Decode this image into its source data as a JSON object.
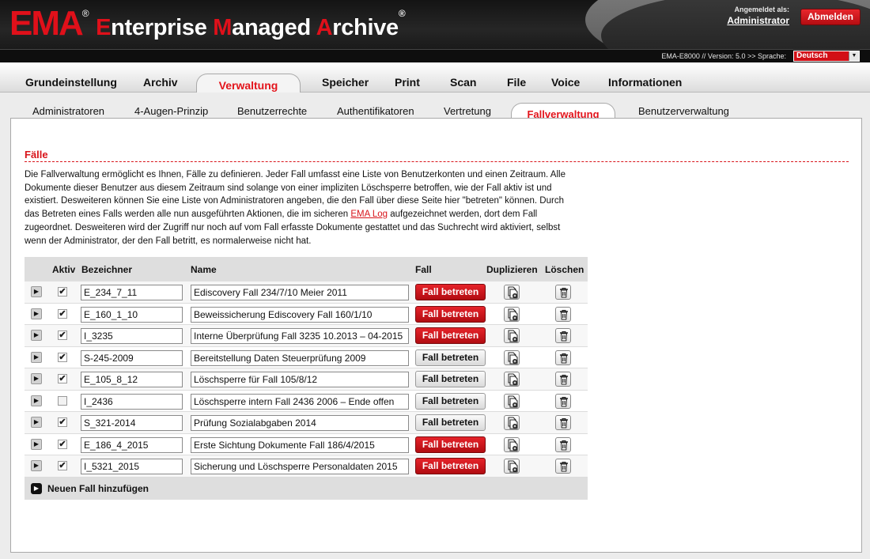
{
  "header": {
    "logo_short": "EMA",
    "logo_reg": "®",
    "title_parts": [
      {
        "cap": "E",
        "rest": "nterprise "
      },
      {
        "cap": "M",
        "rest": "anaged "
      },
      {
        "cap": "A",
        "rest": "rchive"
      }
    ],
    "title_reg": "®",
    "login_label": "Angemeldet als:",
    "login_user": "Administrator",
    "logout_label": "Abmelden"
  },
  "version_bar": {
    "text": "EMA-E8000 // Version: 5.0 >> Sprache:",
    "language": "Deutsch"
  },
  "main_tabs": [
    {
      "label": "Grundeinstellung"
    },
    {
      "label": "Archiv"
    },
    {
      "label": "Verwaltung",
      "active": true
    },
    {
      "label": "Speicher"
    },
    {
      "label": "Print"
    },
    {
      "label": "Scan"
    },
    {
      "label": "File"
    },
    {
      "label": "Voice"
    },
    {
      "label": "Informationen"
    }
  ],
  "sub_tabs": [
    {
      "label": "Administratoren"
    },
    {
      "label": "4-Augen-Prinzip"
    },
    {
      "label": "Benutzerrechte"
    },
    {
      "label": "Authentifikatoren"
    },
    {
      "label": "Vertretung"
    },
    {
      "label": "Fallverwaltung",
      "active": true
    },
    {
      "label": "Benutzerverwaltung"
    }
  ],
  "content": {
    "section_title": "Fälle",
    "intro_before_link": "Die Fallverwaltung ermöglicht es Ihnen, Fälle zu definieren. Jeder Fall umfasst eine Liste von Benutzerkonten und einen Zeitraum. Alle Dokumente dieser Benutzer aus diesem Zeitraum sind solange von einer impliziten Löschsperre betroffen, wie der Fall aktiv ist und existiert. Desweiteren können Sie eine Liste von Administratoren angeben, die den Fall über diese Seite hier \"betreten\" können. Durch das Betreten eines Falls werden alle nun ausgeführten Aktionen, die im sicheren ",
    "intro_link": "EMA Log",
    "intro_after_link": " aufgezeichnet werden, dort dem Fall zugeordnet. Desweiteren wird der Zugriff nur noch auf vom Fall erfasste Dokumente gestattet und das Suchrecht wird aktiviert, selbst wenn der Administrator, der den Fall betritt, es normalerweise nicht hat."
  },
  "table": {
    "headers": {
      "aktiv": "Aktiv",
      "bezeichner": "Bezeichner",
      "name": "Name",
      "fall": "Fall",
      "duplizieren": "Duplizieren",
      "loeschen": "Löschen"
    },
    "enter_label": "Fall betreten",
    "rows": [
      {
        "active": true,
        "code": "E_234_7_11",
        "name": "Ediscovery Fall 234/7/10 Meier 2011",
        "entered": true
      },
      {
        "active": true,
        "code": "E_160_1_10",
        "name": "Beweissicherung Ediscovery Fall 160/1/10",
        "entered": true
      },
      {
        "active": true,
        "code": "I_3235",
        "name": "Interne Überprüfung Fall 3235 10.2013 – 04-2015",
        "entered": true
      },
      {
        "active": true,
        "code": "S-245-2009",
        "name": "Bereitstellung Daten Steuerprüfung 2009",
        "entered": false
      },
      {
        "active": true,
        "code": "E_105_8_12",
        "name": "Löschsperre für Fall 105/8/12",
        "entered": false
      },
      {
        "active": false,
        "code": "I_2436",
        "name": "Löschsperre intern Fall 2436 2006 – Ende offen",
        "entered": false
      },
      {
        "active": true,
        "code": "S_321-2014",
        "name": "Prüfung Sozialabgaben 2014",
        "entered": false
      },
      {
        "active": true,
        "code": "E_186_4_2015",
        "name": "Erste Sichtung Dokumente Fall 186/4/2015",
        "entered": true
      },
      {
        "active": true,
        "code": "I_5321_2015",
        "name": "Sicherung und Löschsperre Personaldaten 2015",
        "entered": true
      }
    ],
    "add_label": "Neuen Fall hinzufügen"
  },
  "colors": {
    "accent_red": "#e3141b",
    "header_dark": "#1a1a1a",
    "table_header_grey": "#dedede"
  },
  "icons": {
    "expand": "play-triangle-icon",
    "duplicate": "duplicate-document-icon",
    "delete": "trash-icon",
    "checkbox": "checkmark-icon",
    "language_dropdown": "chevron-down-icon"
  }
}
